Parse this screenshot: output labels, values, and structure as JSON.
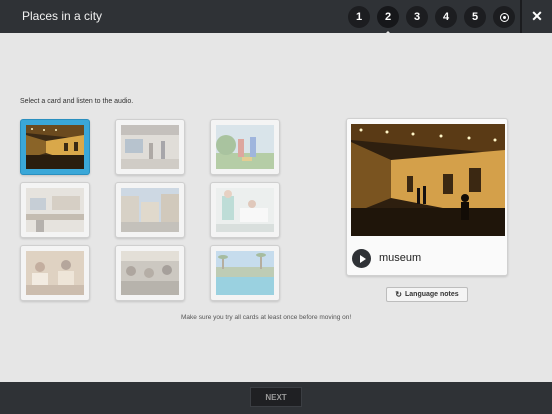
{
  "header": {
    "title": "Places in a city",
    "steps": [
      "1",
      "2",
      "3",
      "4",
      "5"
    ],
    "active_step": "2",
    "close_icon": "close-icon",
    "final_step_icon": "radio-target-icon"
  },
  "activity": {
    "instruction": "Select a card and listen to the audio.",
    "cards": [
      {
        "scene": "museum-gallery",
        "selected": true
      },
      {
        "scene": "airport-hall",
        "selected": false
      },
      {
        "scene": "park-people",
        "selected": false
      },
      {
        "scene": "office-desks",
        "selected": false
      },
      {
        "scene": "shopping-street",
        "selected": false
      },
      {
        "scene": "hospital-room",
        "selected": false
      },
      {
        "scene": "restaurant-diners",
        "selected": false
      },
      {
        "scene": "market-crowd",
        "selected": false
      },
      {
        "scene": "swimming-pool",
        "selected": false
      }
    ],
    "detail": {
      "word": "museum",
      "play_icon": "play-icon"
    },
    "language_notes_label": "Language notes",
    "hint": "Make sure you try all cards at least once before moving on!"
  },
  "footer": {
    "next_label": "NEXT"
  },
  "colors": {
    "bar": "#2f3236",
    "selected_card": "#3aa7d8",
    "background": "#e6e6e6"
  }
}
